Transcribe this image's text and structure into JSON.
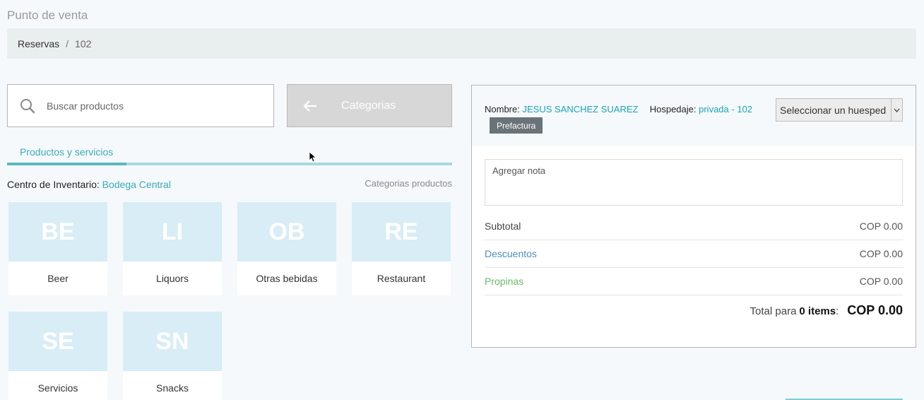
{
  "page": {
    "title": "Punto de venta"
  },
  "breadcrumb": {
    "items": [
      {
        "label": "Reservas"
      },
      {
        "label": "102"
      }
    ],
    "separator": "/"
  },
  "search": {
    "placeholder": "Buscar productos",
    "value": ""
  },
  "categories_button": {
    "label": "Categorias"
  },
  "tabs": {
    "active": "Productos y servicios"
  },
  "inventory": {
    "label": "Centro de Inventario:",
    "value": "Bodega Central",
    "categories_link": "Categorias productos"
  },
  "categories": [
    {
      "abbr": "BE",
      "name": "Beer"
    },
    {
      "abbr": "LI",
      "name": "Liquors"
    },
    {
      "abbr": "OB",
      "name": "Otras bebidas"
    },
    {
      "abbr": "RE",
      "name": "Restaurant"
    },
    {
      "abbr": "SE",
      "name": "Servicios"
    },
    {
      "abbr": "SN",
      "name": "Snacks"
    }
  ],
  "order": {
    "name_label": "Nombre:",
    "name_value": "JESUS SANCHEZ SUAREZ",
    "stay_label": "Hospedaje:",
    "stay_value": "privada - 102",
    "prefactura_label": "Prefactura",
    "guest_select": "Seleccionar un huesped",
    "note_placeholder": "Agregar nota",
    "subtotal_label": "Subtotal",
    "subtotal_value": "COP 0.00",
    "discounts_label": "Descuentos",
    "discounts_value": "COP 0.00",
    "tips_label": "Propinas",
    "tips_value": "COP 0.00",
    "total_prefix": "Total para",
    "total_items": "0 items",
    "total_colon": ":",
    "total_value": "COP 0.00"
  },
  "colors": {
    "accent": "#3aaab8",
    "tile_bg": "#d8edf5",
    "discount": "#4d8fc0",
    "tips": "#6bbb6b"
  }
}
